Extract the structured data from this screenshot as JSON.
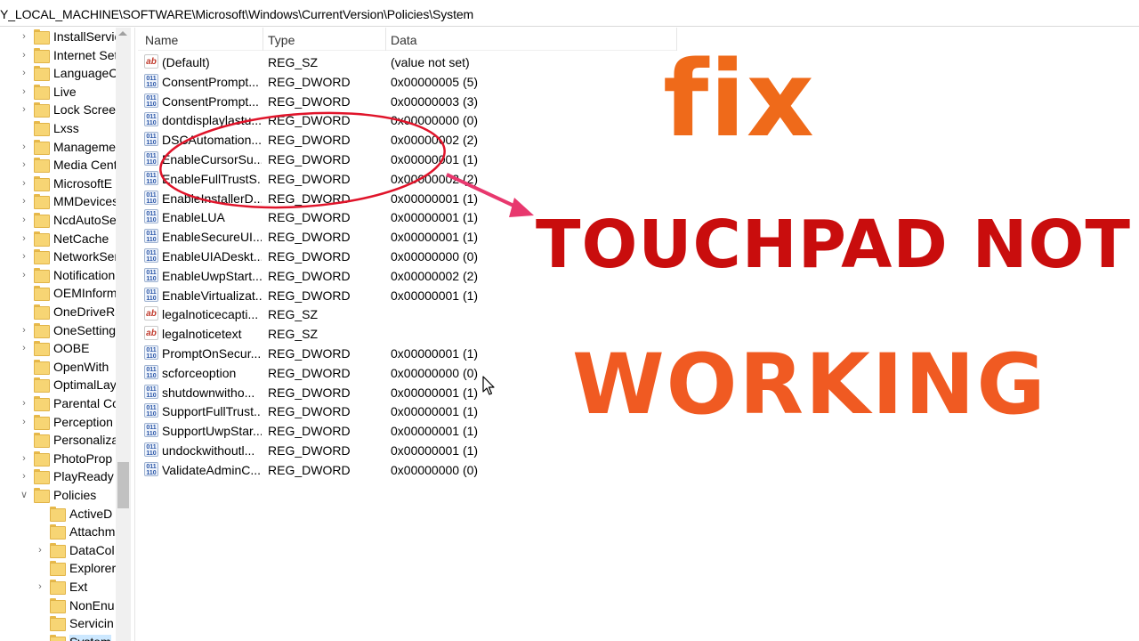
{
  "address_bar": {
    "path": "Y_LOCAL_MACHINE\\SOFTWARE\\Microsoft\\Windows\\CurrentVersion\\Policies\\System"
  },
  "tree": {
    "items": [
      {
        "label": "InstallServic",
        "level": 1,
        "expandable": true
      },
      {
        "label": "Internet Set",
        "level": 1,
        "expandable": true
      },
      {
        "label": "LanguageC",
        "level": 1,
        "expandable": true
      },
      {
        "label": "Live",
        "level": 1,
        "expandable": true
      },
      {
        "label": "Lock Screer",
        "level": 1,
        "expandable": true
      },
      {
        "label": "Lxss",
        "level": 1,
        "expandable": false
      },
      {
        "label": "Manageme",
        "level": 1,
        "expandable": true
      },
      {
        "label": "Media Cent",
        "level": 1,
        "expandable": true
      },
      {
        "label": "MicrosoftE",
        "level": 1,
        "expandable": true
      },
      {
        "label": "MMDevices",
        "level": 1,
        "expandable": true
      },
      {
        "label": "NcdAutoSe",
        "level": 1,
        "expandable": true
      },
      {
        "label": "NetCache",
        "level": 1,
        "expandable": true
      },
      {
        "label": "NetworkSer",
        "level": 1,
        "expandable": true
      },
      {
        "label": "Notification",
        "level": 1,
        "expandable": true
      },
      {
        "label": "OEMInform",
        "level": 1,
        "expandable": false
      },
      {
        "label": "OneDriveRa",
        "level": 1,
        "expandable": false
      },
      {
        "label": "OneSetting",
        "level": 1,
        "expandable": true
      },
      {
        "label": "OOBE",
        "level": 1,
        "expandable": true
      },
      {
        "label": "OpenWith",
        "level": 1,
        "expandable": false
      },
      {
        "label": "OptimalLay",
        "level": 1,
        "expandable": false
      },
      {
        "label": "Parental Co",
        "level": 1,
        "expandable": true
      },
      {
        "label": "Perception",
        "level": 1,
        "expandable": true
      },
      {
        "label": "Personaliza",
        "level": 1,
        "expandable": false
      },
      {
        "label": "PhotoProp",
        "level": 1,
        "expandable": true
      },
      {
        "label": "PlayReady",
        "level": 1,
        "expandable": true
      },
      {
        "label": "Policies",
        "level": 1,
        "expandable": true,
        "expanded": true
      },
      {
        "label": "ActiveD",
        "level": 2,
        "expandable": false
      },
      {
        "label": "Attachm",
        "level": 2,
        "expandable": false
      },
      {
        "label": "DataCol",
        "level": 2,
        "expandable": true
      },
      {
        "label": "Explorer",
        "level": 2,
        "expandable": false
      },
      {
        "label": "Ext",
        "level": 2,
        "expandable": true
      },
      {
        "label": "NonEnu",
        "level": 2,
        "expandable": false
      },
      {
        "label": "Servicin",
        "level": 2,
        "expandable": false
      },
      {
        "label": "System",
        "level": 2,
        "expandable": false,
        "selected": true
      }
    ]
  },
  "list": {
    "columns": {
      "name": "Name",
      "type": "Type",
      "data": "Data"
    },
    "rows": [
      {
        "icon": "ab",
        "name": "(Default)",
        "type": "REG_SZ",
        "data": "(value not set)"
      },
      {
        "icon": "dword",
        "name": "ConsentPrompt...",
        "type": "REG_DWORD",
        "data": "0x00000005 (5)"
      },
      {
        "icon": "dword",
        "name": "ConsentPrompt...",
        "type": "REG_DWORD",
        "data": "0x00000003 (3)"
      },
      {
        "icon": "dword",
        "name": "dontdisplaylastu...",
        "type": "REG_DWORD",
        "data": "0x00000000 (0)"
      },
      {
        "icon": "dword",
        "name": "DSCAutomation...",
        "type": "REG_DWORD",
        "data": "0x00000002 (2)"
      },
      {
        "icon": "dword",
        "name": "EnableCursorSu...",
        "type": "REG_DWORD",
        "data": "0x00000001 (1)"
      },
      {
        "icon": "dword",
        "name": "EnableFullTrustS...",
        "type": "REG_DWORD",
        "data": "0x00000002 (2)"
      },
      {
        "icon": "dword",
        "name": "EnableInstallerD...",
        "type": "REG_DWORD",
        "data": "0x00000001 (1)"
      },
      {
        "icon": "dword",
        "name": "EnableLUA",
        "type": "REG_DWORD",
        "data": "0x00000001 (1)"
      },
      {
        "icon": "dword",
        "name": "EnableSecureUI...",
        "type": "REG_DWORD",
        "data": "0x00000001 (1)"
      },
      {
        "icon": "dword",
        "name": "EnableUIADeskt...",
        "type": "REG_DWORD",
        "data": "0x00000000 (0)"
      },
      {
        "icon": "dword",
        "name": "EnableUwpStart...",
        "type": "REG_DWORD",
        "data": "0x00000002 (2)"
      },
      {
        "icon": "dword",
        "name": "EnableVirtualizat...",
        "type": "REG_DWORD",
        "data": "0x00000001 (1)"
      },
      {
        "icon": "ab",
        "name": "legalnoticecapti...",
        "type": "REG_SZ",
        "data": ""
      },
      {
        "icon": "ab",
        "name": "legalnoticetext",
        "type": "REG_SZ",
        "data": ""
      },
      {
        "icon": "dword",
        "name": "PromptOnSecur...",
        "type": "REG_DWORD",
        "data": "0x00000001 (1)"
      },
      {
        "icon": "dword",
        "name": "scforceoption",
        "type": "REG_DWORD",
        "data": "0x00000000 (0)"
      },
      {
        "icon": "dword",
        "name": "shutdownwitho...",
        "type": "REG_DWORD",
        "data": "0x00000001 (1)"
      },
      {
        "icon": "dword",
        "name": "SupportFullTrust...",
        "type": "REG_DWORD",
        "data": "0x00000001 (1)"
      },
      {
        "icon": "dword",
        "name": "SupportUwpStar...",
        "type": "REG_DWORD",
        "data": "0x00000001 (1)"
      },
      {
        "icon": "dword",
        "name": "undockwithoutl...",
        "type": "REG_DWORD",
        "data": "0x00000001 (1)"
      },
      {
        "icon": "dword",
        "name": "ValidateAdminC...",
        "type": "REG_DWORD",
        "data": "0x00000000 (0)"
      }
    ]
  },
  "overlay": {
    "line1": "fix",
    "line2": "TOUCHPAD NOT",
    "line3": "WORKING",
    "colors": {
      "fix": "#ef6a1a",
      "touchpad": "#c90d0d",
      "working": "#f05a22",
      "annotation": "#e0142a",
      "arrow": "#e8386e"
    }
  },
  "icons": {
    "string_value": "ab",
    "dword_value": "011 110"
  }
}
